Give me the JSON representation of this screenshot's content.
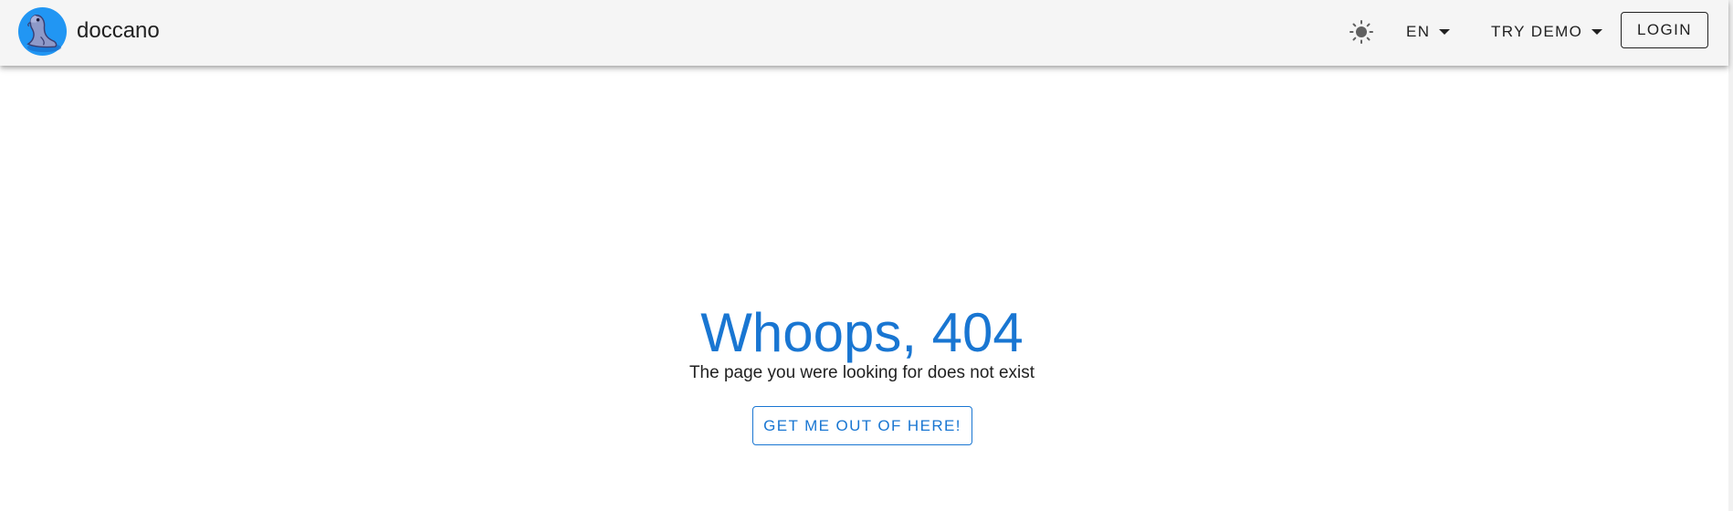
{
  "app_bar": {
    "brand": "doccano",
    "logo_icon": "seal-logo-icon",
    "theme_icon": "sun-icon",
    "language_label": "EN",
    "demo_label": "TRY DEMO",
    "login_label": "LOGIN"
  },
  "main": {
    "title": "Whoops, 404",
    "subtitle": "The page you were looking for does not exist",
    "escape_label": "GET ME OUT OF HERE!"
  },
  "colors": {
    "accent": "#1976d2",
    "app_bar_bg": "#f5f5f5",
    "text": "#212121",
    "logo_bg": "#2196f3"
  }
}
